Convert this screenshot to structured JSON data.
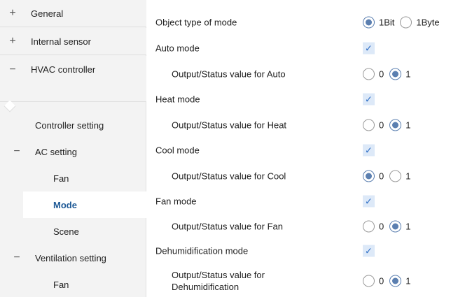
{
  "sidebar": {
    "items": [
      {
        "label": "General",
        "sign": "+"
      },
      {
        "label": "Internal sensor",
        "sign": "+"
      },
      {
        "label": "HVAC controller",
        "sign": "−"
      },
      {
        "label": "Controller setting"
      },
      {
        "label": "AC setting",
        "sign": "−"
      },
      {
        "label": "Fan"
      },
      {
        "label": "Mode"
      },
      {
        "label": "Scene"
      },
      {
        "label": "Ventilation setting",
        "sign": "−"
      },
      {
        "label": "Fan"
      }
    ]
  },
  "params": [
    {
      "label": "Object type of mode",
      "type": "radio",
      "options": [
        "1Bit",
        "1Byte"
      ],
      "selected": "1Bit"
    },
    {
      "label": "Auto mode",
      "type": "checkbox",
      "checked": true
    },
    {
      "label": "Output/Status value for Auto",
      "type": "radio",
      "options": [
        "0",
        "1"
      ],
      "selected": "1"
    },
    {
      "label": "Heat mode",
      "type": "checkbox",
      "checked": true
    },
    {
      "label": "Output/Status value for Heat",
      "type": "radio",
      "options": [
        "0",
        "1"
      ],
      "selected": "1"
    },
    {
      "label": "Cool mode",
      "type": "checkbox",
      "checked": true
    },
    {
      "label": "Output/Status value for Cool",
      "type": "radio",
      "options": [
        "0",
        "1"
      ],
      "selected": "0"
    },
    {
      "label": "Fan mode",
      "type": "checkbox",
      "checked": true
    },
    {
      "label": "Output/Status value for Fan",
      "type": "radio",
      "options": [
        "0",
        "1"
      ],
      "selected": "1"
    },
    {
      "label": "Dehumidification mode",
      "type": "checkbox",
      "checked": true
    },
    {
      "label_line1": "Output/Status value for",
      "label_line2": "Dehumidification",
      "type": "radio",
      "options": [
        "0",
        "1"
      ],
      "selected": "1"
    }
  ],
  "icons": {
    "checkmark": "✓"
  },
  "colors": {
    "accent": "#1f5a96",
    "radio": "#5b7fb0",
    "check_bg": "#dde9f8"
  }
}
